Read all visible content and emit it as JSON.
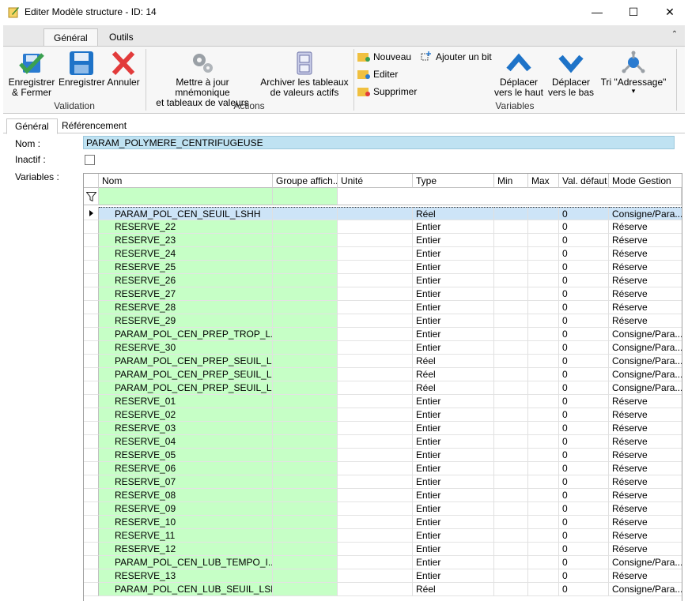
{
  "window": {
    "title": "Editer Modèle structure - ID: 14",
    "minimize": "—",
    "maximize": "☐",
    "close": "✕"
  },
  "ribbon": {
    "tabs": [
      "Général",
      "Outils"
    ],
    "collapse": "⌃",
    "groups": {
      "validation": {
        "label": "Validation",
        "save_close_1": "Enregistrer",
        "save_close_2": "& Fermer",
        "save": "Enregistrer",
        "cancel": "Annuler"
      },
      "actions": {
        "label": "Actions",
        "update_1": "Mettre à jour mnémonique",
        "update_2": "et tableaux de valeurs",
        "archive_1": "Archiver les tableaux",
        "archive_2": "de valeurs actifs"
      },
      "variables": {
        "label": "Variables",
        "new": "Nouveau",
        "edit": "Editer",
        "delete": "Supprimer",
        "add_bit": "Ajouter un bit",
        "move_up_1": "Déplacer",
        "move_up_2": "vers le haut",
        "move_down_1": "Déplacer",
        "move_down_2": "vers le bas",
        "sort": "Tri \"Adressage\"",
        "sort_caret": "▾"
      }
    }
  },
  "subtabs": [
    "Général",
    "Référencement"
  ],
  "form": {
    "nom_label": "Nom :",
    "nom_value": "PARAM_POLYMERE_CENTRIFUGEUSE",
    "inactif_label": "Inactif :",
    "variables_label": "Variables :"
  },
  "grid": {
    "columns": [
      "Nom",
      "Groupe affich...",
      "Unité",
      "Type",
      "Min",
      "Max",
      "Val. défaut",
      "Mode Gestion"
    ],
    "filter_icon": "filter-icon",
    "rows": [
      {
        "nom": "PARAM_POL_CEN_SEUIL_LSHH",
        "type": "Réel",
        "def": "0",
        "mode": "Consigne/Para..."
      },
      {
        "nom": "RESERVE_22",
        "type": "Entier",
        "def": "0",
        "mode": "Réserve"
      },
      {
        "nom": "RESERVE_23",
        "type": "Entier",
        "def": "0",
        "mode": "Réserve"
      },
      {
        "nom": "RESERVE_24",
        "type": "Entier",
        "def": "0",
        "mode": "Réserve"
      },
      {
        "nom": "RESERVE_25",
        "type": "Entier",
        "def": "0",
        "mode": "Réserve"
      },
      {
        "nom": "RESERVE_26",
        "type": "Entier",
        "def": "0",
        "mode": "Réserve"
      },
      {
        "nom": "RESERVE_27",
        "type": "Entier",
        "def": "0",
        "mode": "Réserve"
      },
      {
        "nom": "RESERVE_28",
        "type": "Entier",
        "def": "0",
        "mode": "Réserve"
      },
      {
        "nom": "RESERVE_29",
        "type": "Entier",
        "def": "0",
        "mode": "Réserve"
      },
      {
        "nom": "PARAM_POL_CEN_PREP_TROP_L...",
        "type": "Entier",
        "def": "0",
        "mode": "Consigne/Para..."
      },
      {
        "nom": "RESERVE_30",
        "type": "Entier",
        "def": "0",
        "mode": "Consigne/Para..."
      },
      {
        "nom": "PARAM_POL_CEN_PREP_SEUIL_L...",
        "type": "Réel",
        "def": "0",
        "mode": "Consigne/Para..."
      },
      {
        "nom": "PARAM_POL_CEN_PREP_SEUIL_L...",
        "type": "Réel",
        "def": "0",
        "mode": "Consigne/Para..."
      },
      {
        "nom": "PARAM_POL_CEN_PREP_SEUIL_L...",
        "type": "Réel",
        "def": "0",
        "mode": "Consigne/Para..."
      },
      {
        "nom": "RESERVE_01",
        "type": "Entier",
        "def": "0",
        "mode": "Réserve"
      },
      {
        "nom": "RESERVE_02",
        "type": "Entier",
        "def": "0",
        "mode": "Réserve"
      },
      {
        "nom": "RESERVE_03",
        "type": "Entier",
        "def": "0",
        "mode": "Réserve"
      },
      {
        "nom": "RESERVE_04",
        "type": "Entier",
        "def": "0",
        "mode": "Réserve"
      },
      {
        "nom": "RESERVE_05",
        "type": "Entier",
        "def": "0",
        "mode": "Réserve"
      },
      {
        "nom": "RESERVE_06",
        "type": "Entier",
        "def": "0",
        "mode": "Réserve"
      },
      {
        "nom": "RESERVE_07",
        "type": "Entier",
        "def": "0",
        "mode": "Réserve"
      },
      {
        "nom": "RESERVE_08",
        "type": "Entier",
        "def": "0",
        "mode": "Réserve"
      },
      {
        "nom": "RESERVE_09",
        "type": "Entier",
        "def": "0",
        "mode": "Réserve"
      },
      {
        "nom": "RESERVE_10",
        "type": "Entier",
        "def": "0",
        "mode": "Réserve"
      },
      {
        "nom": "RESERVE_11",
        "type": "Entier",
        "def": "0",
        "mode": "Réserve"
      },
      {
        "nom": "RESERVE_12",
        "type": "Entier",
        "def": "0",
        "mode": "Réserve"
      },
      {
        "nom": "PARAM_POL_CEN_LUB_TEMPO_I...",
        "type": "Entier",
        "def": "0",
        "mode": "Consigne/Para..."
      },
      {
        "nom": "RESERVE_13",
        "type": "Entier",
        "def": "0",
        "mode": "Réserve"
      },
      {
        "nom": "PARAM_POL_CEN_LUB_SEUIL_LSH",
        "type": "Réel",
        "def": "0",
        "mode": "Consigne/Para..."
      }
    ]
  },
  "colors": {
    "accent_blue": "#1e73c8",
    "check_green": "#3aa050",
    "cancel_red": "#e23b3b",
    "nom_column_bg": "#c6ffc6",
    "name_field_bg": "#bfe2f2"
  }
}
